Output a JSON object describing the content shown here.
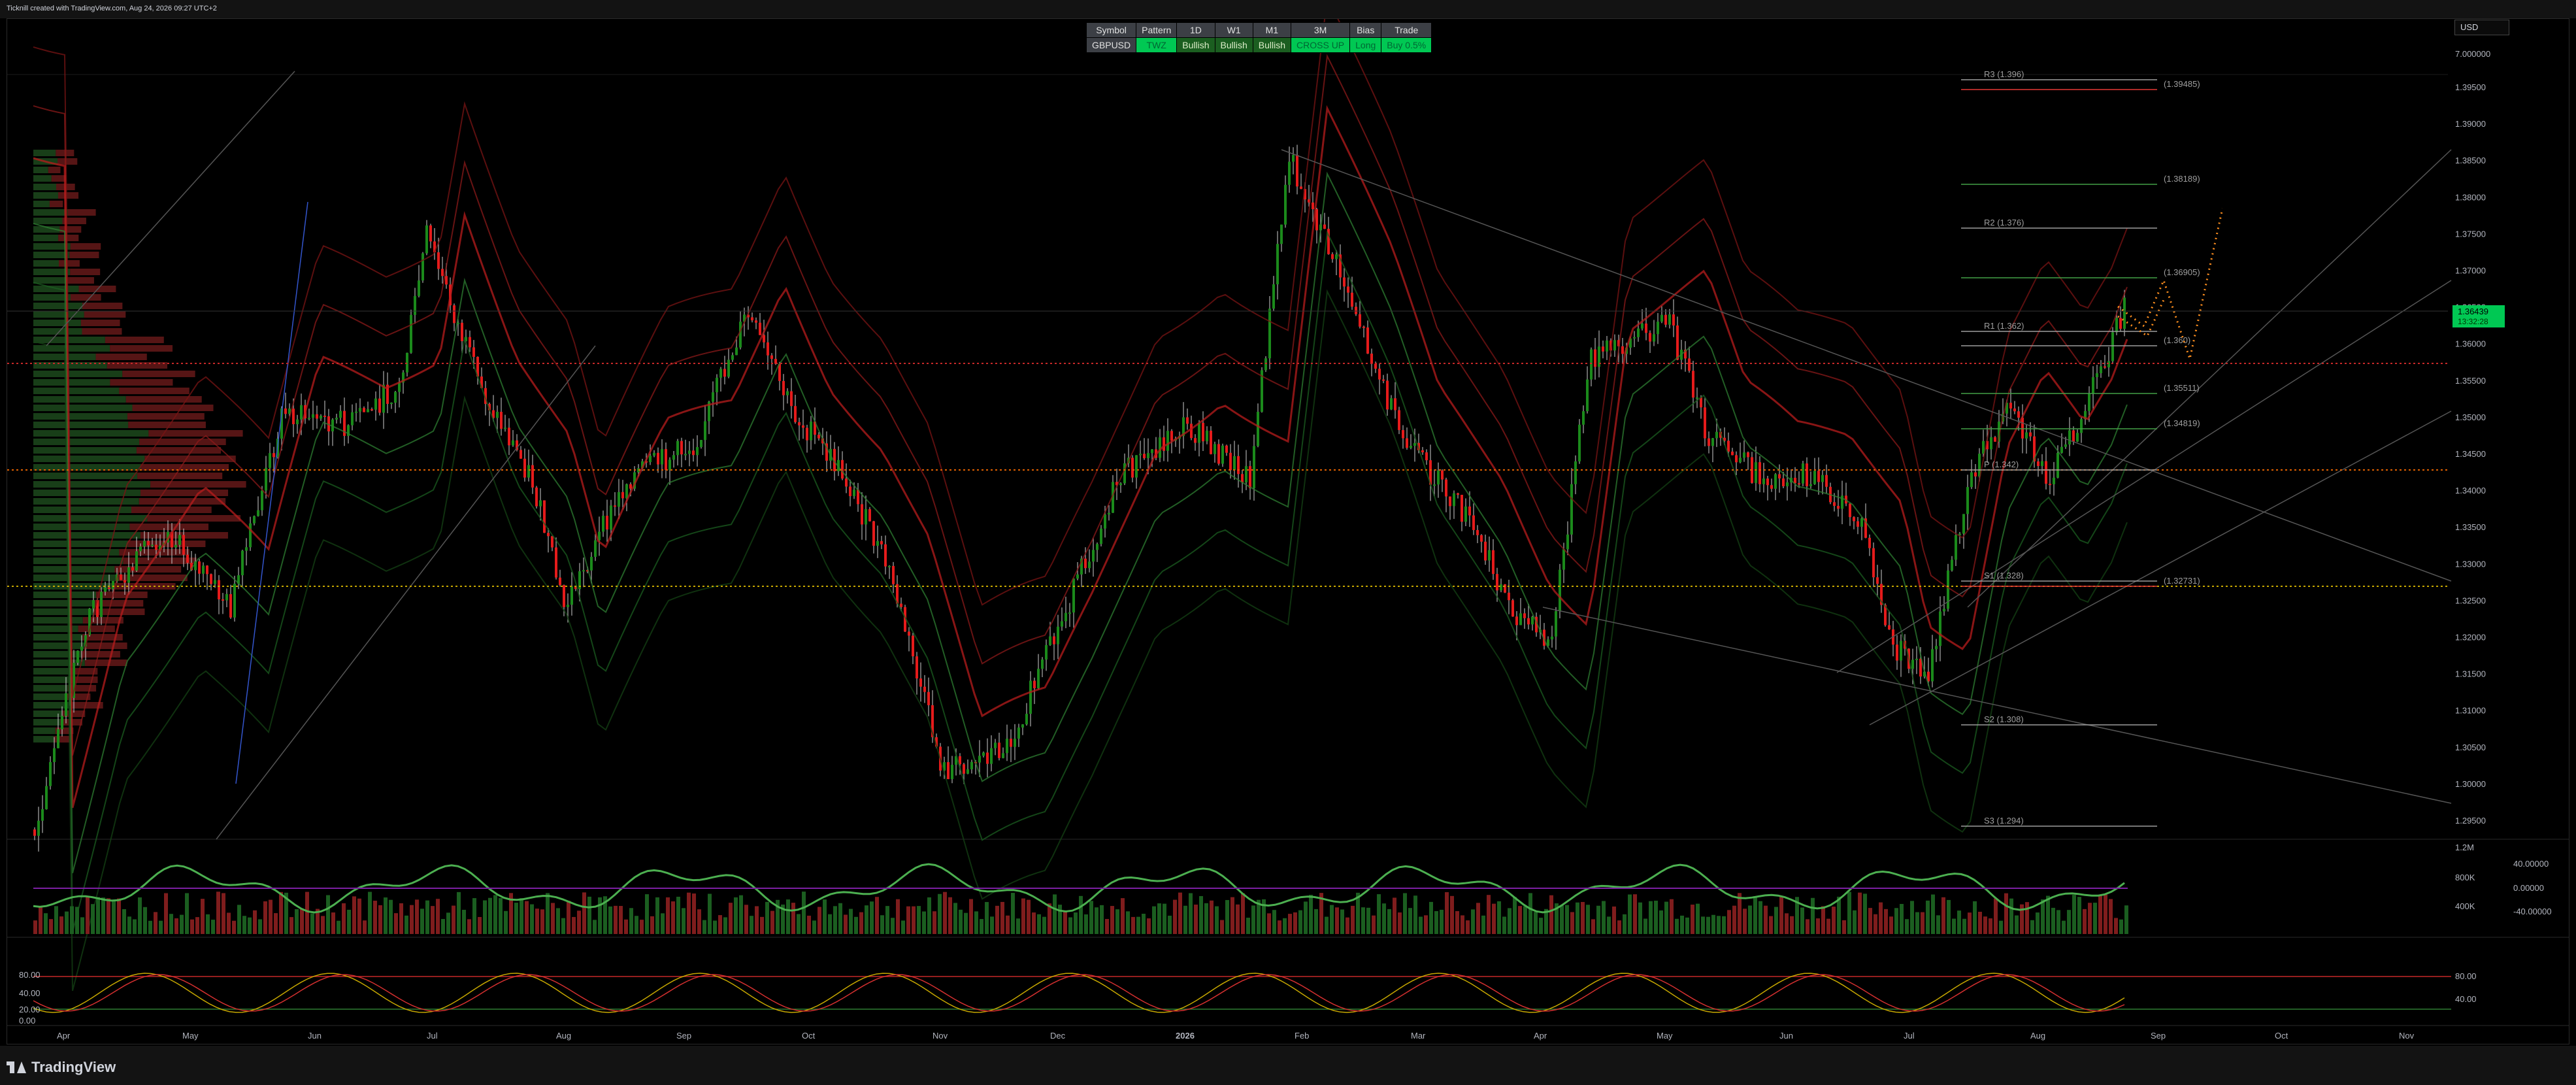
{
  "credit": "Ticknill created with TradingView.com, Aug 24, 2026 09:27 UTC+2",
  "currency_select": "USD",
  "signal_table": {
    "headers": [
      "Symbol",
      "Pattern",
      "1D",
      "W1",
      "M1",
      "3M",
      "Bias",
      "Trade"
    ],
    "values": [
      "GBPUSD",
      "TWZ",
      "Bullish",
      "Bullish",
      "Bullish",
      "CROSS UP",
      "Long",
      "Buy 0.5%"
    ]
  },
  "price_scale": {
    "top_label": "7.000000",
    "labels": [
      "1.39500",
      "1.39000",
      "1.38500",
      "1.38000",
      "1.37500",
      "1.37000",
      "1.36500",
      "1.36000",
      "1.35500",
      "1.35000",
      "1.34500",
      "1.34000",
      "1.33500",
      "1.33000",
      "1.32500",
      "1.32000",
      "1.31500",
      "1.31000",
      "1.30500",
      "1.30000",
      "1.29500"
    ],
    "current_price": "1.36439",
    "countdown": "13:32:28"
  },
  "pivots": [
    {
      "label": "R3 (1.396)"
    },
    {
      "label": "(1.39485)",
      "color": "#e53935"
    },
    {
      "label": "(1.38189)",
      "color": "#43a047"
    },
    {
      "label": "R2 (1.376)"
    },
    {
      "label": "(1.36905)",
      "color": "#43a047"
    },
    {
      "label": "R1 (1.362)"
    },
    {
      "label": "(1.360)",
      "color": "#9e9e9e"
    },
    {
      "label": "(1.35511)",
      "color": "#43a047"
    },
    {
      "label": "(1.34819)",
      "color": "#43a047"
    },
    {
      "label": "P (1.342)"
    },
    {
      "label": "S1 (1.328)"
    },
    {
      "label": "(1.32731)",
      "color": "#e53935"
    },
    {
      "label": "S2 (1.308)"
    },
    {
      "label": "S3 (1.294)"
    }
  ],
  "osc_scale": {
    "volume": [
      "1.2M",
      "800K",
      "400K"
    ],
    "rsi_right": [
      "40.00000",
      "0.00000",
      "-40.00000"
    ]
  },
  "stoch_scale": {
    "left": [
      "80.00",
      "40.00",
      "20.00",
      "0.00"
    ],
    "right": [
      "80.00",
      "40.00"
    ]
  },
  "time_axis": [
    "Apr",
    "May",
    "Jun",
    "Jul",
    "Aug",
    "Sep",
    "Oct",
    "Nov",
    "Dec",
    "2026",
    "Feb",
    "Mar",
    "Apr",
    "May",
    "Jun",
    "Jul",
    "Aug",
    "Sep",
    "Oct",
    "Nov"
  ],
  "brand": "TradingView",
  "colors": {
    "bull": "#1b8a1b",
    "bear": "#e51b1b",
    "accent": "#00c853"
  }
}
